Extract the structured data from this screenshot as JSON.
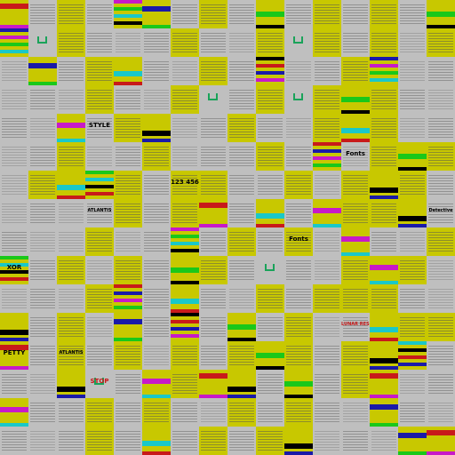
{
  "app_title": "",
  "palette": {
    "gray": "#bfbfbf",
    "yellow": "#c8c800",
    "black": "#000000",
    "blue": "#1a1aa8",
    "red": "#c81a1a",
    "magenta": "#c81ac8",
    "green": "#1ac81a",
    "cyan": "#1ac8c8",
    "white": "#e8e8e8"
  },
  "tiles": [
    [
      "img-y",
      "text",
      "y",
      "text",
      "stripes",
      "img-y",
      "text",
      "y",
      "text",
      "img-y",
      "text",
      "y",
      "text",
      "y",
      "text",
      "img-y"
    ],
    [
      "stripes",
      "logo",
      "y",
      "text",
      "gray",
      "text",
      "y",
      "text",
      "gray",
      "y",
      "logo",
      "y",
      "text",
      "y",
      "gray",
      "y"
    ],
    [
      "gray",
      "img-y",
      "text",
      "y",
      "img-y",
      "text",
      "gray",
      "y",
      "text",
      "stripes",
      "gray",
      "text",
      "y",
      "stripes",
      "gray",
      "text"
    ],
    [
      "gray",
      "text",
      "gray",
      "y",
      "text",
      "gray",
      "y",
      "logo",
      "text",
      "y",
      "logo",
      "y",
      "img-y",
      "y",
      "text",
      "gray"
    ],
    [
      "text",
      "gray",
      "img-y",
      "text",
      "y",
      "img-y",
      "gray",
      "text",
      "y",
      "text",
      "gray",
      "y",
      "img-y",
      "y",
      "gray",
      "text"
    ],
    [
      "gray",
      "text",
      "y",
      "gray",
      "text",
      "y",
      "gray",
      "text",
      "text",
      "y",
      "text",
      "stripes",
      "gray",
      "y",
      "img-y",
      "y"
    ],
    [
      "gray",
      "y",
      "img-y",
      "stripes",
      "y",
      "text",
      "y",
      "y",
      "text",
      "text",
      "y",
      "gray",
      "y",
      "img-y",
      "y",
      "text"
    ],
    [
      "gray",
      "text",
      "gray",
      "text",
      "y",
      "text",
      "y",
      "img-y",
      "text",
      "img-y",
      "text",
      "img-y",
      "y",
      "y",
      "img-y",
      "text"
    ],
    [
      "text",
      "gray",
      "gray",
      "y",
      "gray",
      "text",
      "stripes",
      "text",
      "y",
      "text",
      "y",
      "gray",
      "img-y",
      "text",
      "gray",
      "y"
    ],
    [
      "stripes",
      "text",
      "y",
      "gray",
      "y",
      "text",
      "img-y",
      "y",
      "text",
      "logo",
      "text",
      "gray",
      "y",
      "img-y",
      "y",
      "gray"
    ],
    [
      "gray",
      "text",
      "gray",
      "y",
      "stripes",
      "text",
      "img-y",
      "text",
      "gray",
      "y",
      "text",
      "y",
      "y",
      "y",
      "text",
      "gray"
    ],
    [
      "img-y",
      "text",
      "y",
      "gray",
      "img-y",
      "text",
      "stripes",
      "text",
      "img-y",
      "text",
      "y",
      "gray",
      "text",
      "img-y",
      "y",
      "y"
    ],
    [
      "img-y",
      "text",
      "y",
      "text",
      "y",
      "gray",
      "y",
      "text",
      "y",
      "img-y",
      "y",
      "text",
      "y",
      "img-y",
      "stripes",
      "text"
    ],
    [
      "text",
      "gray",
      "img-y",
      "logo",
      "text",
      "img-y",
      "y",
      "img-y",
      "img-y",
      "text",
      "img-y",
      "text",
      "y",
      "img-y",
      "gray",
      "text"
    ],
    [
      "img-y",
      "text",
      "text",
      "y",
      "text",
      "y",
      "text",
      "gray",
      "y",
      "text",
      "y",
      "text",
      "gray",
      "img-y",
      "text",
      "gray"
    ],
    [
      "text",
      "gray",
      "text",
      "y",
      "text",
      "img-y",
      "text",
      "y",
      "text",
      "y",
      "img-y",
      "gray",
      "text",
      "gray",
      "img-y",
      "img-y"
    ]
  ],
  "labels": {
    "2": {
      "5": "123\n456"
    },
    "6": {
      "6": "123\n456"
    },
    "7": {
      "3": "ATLANTIS"
    },
    "8": {
      "6": "",
      "9": ""
    },
    "9": {
      "0": "XOR"
    },
    "11": {
      "12": "LUNAR"
    },
    "12": {
      "2": "ATLANTIS"
    },
    "13": {
      "3": "STOP"
    },
    "14": {
      "0": ""
    }
  },
  "visible_text": {
    "xor": "XOR",
    "atlantis": "ATLANTIS",
    "atlantis2": "ATLANTIS",
    "lunar_rescue": "LUNAR RESCUE",
    "stop": "STOP",
    "numbers": "123 456",
    "style": "STYLE",
    "fonts": "Fonts",
    "fonts2": "Fonts",
    "detective": "Detective",
    "petty": "PETTY"
  }
}
